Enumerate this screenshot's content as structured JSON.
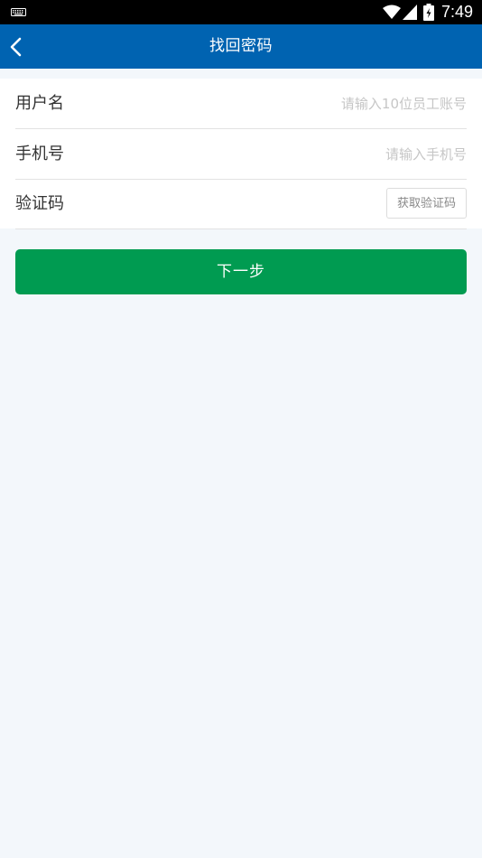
{
  "status_bar": {
    "time": "7:49",
    "icons": [
      "keyboard-icon",
      "wifi-icon",
      "signal-icon",
      "battery-icon"
    ]
  },
  "app_bar": {
    "title": "找回密码",
    "back_icon": "chevron-left-icon",
    "background_color": "#0063b1"
  },
  "form": {
    "username": {
      "label": "用户名",
      "placeholder": "请输入10位员工账号",
      "value": ""
    },
    "phone": {
      "label": "手机号",
      "placeholder": "请输入手机号",
      "value": ""
    },
    "verification": {
      "label": "验证码",
      "value": "",
      "button_label": "获取验证码"
    }
  },
  "next_button": {
    "label": "下一步",
    "color": "#009b51"
  }
}
